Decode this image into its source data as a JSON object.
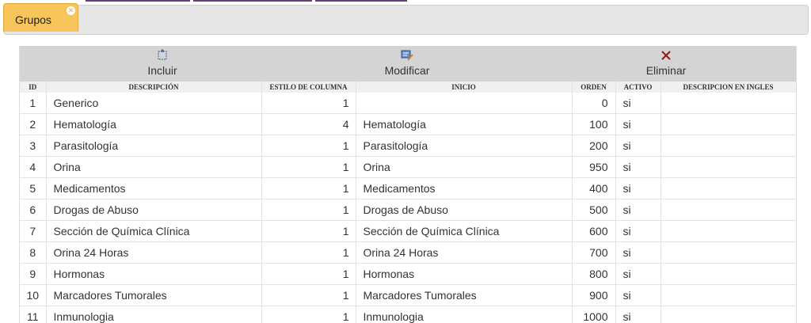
{
  "tab": {
    "label": "Grupos",
    "close_icon": "close-icon"
  },
  "toolbar": {
    "incluir": "Incluir",
    "modificar": "Modificar",
    "eliminar": "Eliminar"
  },
  "columns": [
    "ID",
    "DESCRIPCIÓN",
    "ESTILO DE COLUMNA",
    "INICIO",
    "ORDEN",
    "ACTIVO",
    "DESCRIPCION EN INGLES"
  ],
  "rows": [
    {
      "id": "1",
      "descripcion": "Generico",
      "estilo": "1",
      "inicio": "",
      "orden": "0",
      "activo": "si",
      "ingles": ""
    },
    {
      "id": "2",
      "descripcion": "Hematología",
      "estilo": "4",
      "inicio": "Hematología",
      "orden": "100",
      "activo": "si",
      "ingles": ""
    },
    {
      "id": "3",
      "descripcion": "Parasitología",
      "estilo": "1",
      "inicio": "Parasitología",
      "orden": "200",
      "activo": "si",
      "ingles": ""
    },
    {
      "id": "4",
      "descripcion": "Orina",
      "estilo": "1",
      "inicio": "Orina",
      "orden": "950",
      "activo": "si",
      "ingles": ""
    },
    {
      "id": "5",
      "descripcion": "Medicamentos",
      "estilo": "1",
      "inicio": "Medicamentos",
      "orden": "400",
      "activo": "si",
      "ingles": ""
    },
    {
      "id": "6",
      "descripcion": "Drogas de Abuso",
      "estilo": "1",
      "inicio": "Drogas de Abuso",
      "orden": "500",
      "activo": "si",
      "ingles": ""
    },
    {
      "id": "7",
      "descripcion": "Sección de Química Clínica",
      "estilo": "1",
      "inicio": "Sección de Química Clínica",
      "orden": "600",
      "activo": "si",
      "ingles": ""
    },
    {
      "id": "8",
      "descripcion": "Orina 24 Horas",
      "estilo": "1",
      "inicio": "Orina 24 Horas",
      "orden": "700",
      "activo": "si",
      "ingles": ""
    },
    {
      "id": "9",
      "descripcion": "Hormonas",
      "estilo": "1",
      "inicio": "Hormonas",
      "orden": "800",
      "activo": "si",
      "ingles": ""
    },
    {
      "id": "10",
      "descripcion": "Marcadores Tumorales",
      "estilo": "1",
      "inicio": "Marcadores Tumorales",
      "orden": "900",
      "activo": "si",
      "ingles": ""
    },
    {
      "id": "11",
      "descripcion": "Inmunologia",
      "estilo": "1",
      "inicio": "Inmunologia",
      "orden": "1000",
      "activo": "si",
      "ingles": ""
    }
  ],
  "colors": {
    "tab_bg": "#f8c55c",
    "toolbar_bg": "#d4d4d4",
    "header_bg": "#f0f0f0",
    "accent_strip": "#6a3f80"
  }
}
